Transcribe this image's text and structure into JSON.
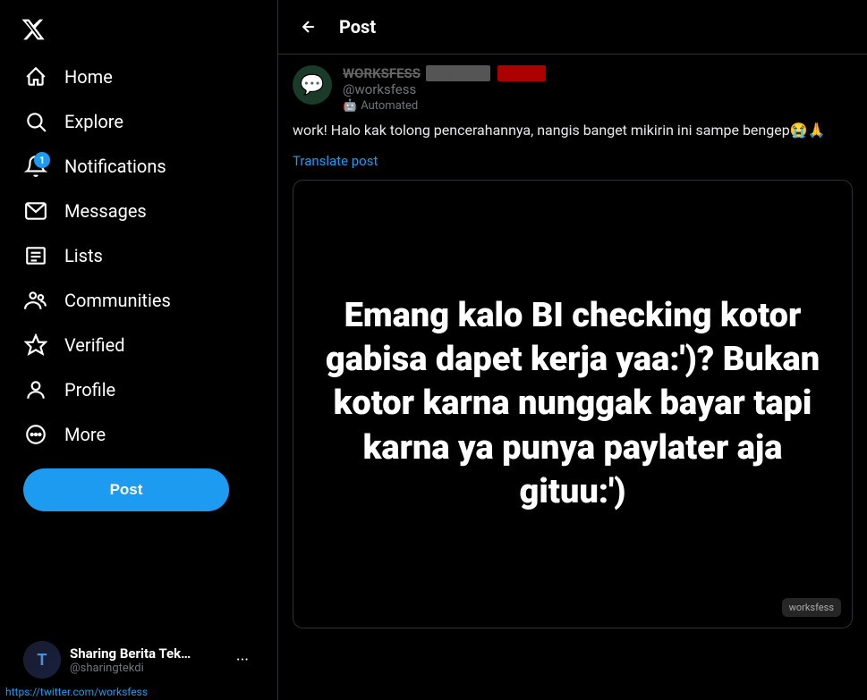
{
  "sidebar": {
    "logo_label": "X",
    "nav_items": [
      {
        "id": "home",
        "label": "Home",
        "icon": "home"
      },
      {
        "id": "explore",
        "label": "Explore",
        "icon": "search"
      },
      {
        "id": "notifications",
        "label": "Notifications",
        "icon": "bell",
        "badge": "1"
      },
      {
        "id": "messages",
        "label": "Messages",
        "icon": "mail"
      },
      {
        "id": "lists",
        "label": "Lists",
        "icon": "list"
      },
      {
        "id": "communities",
        "label": "Communities",
        "icon": "communities"
      },
      {
        "id": "verified",
        "label": "Verified",
        "icon": "verified"
      },
      {
        "id": "profile",
        "label": "Profile",
        "icon": "person"
      }
    ],
    "more_label": "More",
    "post_button_label": "Post",
    "account": {
      "name": "Sharing Berita Tek…",
      "handle": "@sharingtekdi",
      "avatar_letter": "T"
    }
  },
  "main": {
    "header": {
      "back_label": "←",
      "title": "Post"
    },
    "tweet": {
      "username": "WORKSFESS",
      "handle": "@worksfess",
      "automated_label": "Automated",
      "content": "work! Halo kak tolong pencerahannya, nangis banget mikirin ini sampe bengep😭🙏",
      "translate_label": "Translate post",
      "image_text": "Emang kalo BI checking kotor gabisa dapet kerja yaa:')? Bukan kotor karna nunggak bayar tapi karna ya punya paylater aja gituu:')",
      "watermark_label": "worksfess"
    }
  },
  "status_bar": {
    "url": "https://twitter.com/worksfess"
  }
}
